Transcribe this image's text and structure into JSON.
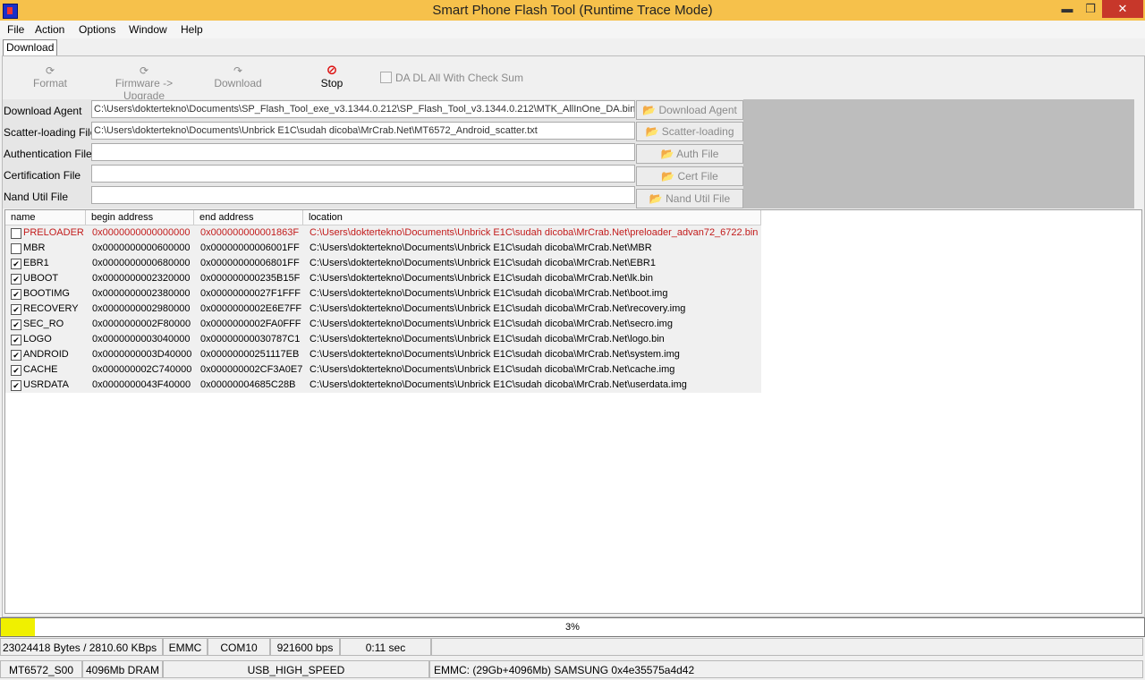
{
  "window": {
    "title": "Smart Phone Flash Tool (Runtime Trace Mode)",
    "min_glyph": "▬",
    "max_glyph": "❐",
    "close_glyph": "✕"
  },
  "menu": [
    "File",
    "Action",
    "Options",
    "Window",
    "Help"
  ],
  "tab": "Download",
  "toolbar": {
    "format": "Format",
    "firmware": "Firmware -> Upgrade",
    "download": "Download",
    "stop": "Stop",
    "format_icon": "⟳",
    "firmware_icon": "⟳",
    "download_icon": "↷",
    "stop_icon": "⊘",
    "da_checksum": "DA DL All With Check Sum"
  },
  "files": [
    {
      "label": "Download Agent",
      "value": "C:\\Users\\doktertekno\\Documents\\SP_Flash_Tool_exe_v3.1344.0.212\\SP_Flash_Tool_v3.1344.0.212\\MTK_AllInOne_DA.bin",
      "button": "Download Agent"
    },
    {
      "label": "Scatter-loading File",
      "value": "C:\\Users\\doktertekno\\Documents\\Unbrick E1C\\sudah dicoba\\MrCrab.Net\\MT6572_Android_scatter.txt",
      "button": "Scatter-loading"
    },
    {
      "label": "Authentication File",
      "value": "",
      "button": "Auth File"
    },
    {
      "label": "Certification File",
      "value": "",
      "button": "Cert File"
    },
    {
      "label": "Nand Util File",
      "value": "",
      "button": "Nand Util File"
    }
  ],
  "table": {
    "headers": [
      "name",
      "begin address",
      "end address",
      "location"
    ],
    "rows": [
      {
        "checked": false,
        "name": "PRELOADER",
        "begin": "0x0000000000000000",
        "end": "0x000000000001863F",
        "location": "C:\\Users\\doktertekno\\Documents\\Unbrick E1C\\sudah dicoba\\MrCrab.Net\\preloader_advan72_6722.bin",
        "highlight": true
      },
      {
        "checked": false,
        "name": "MBR",
        "begin": "0x0000000000600000",
        "end": "0x00000000006001FF",
        "location": "C:\\Users\\doktertekno\\Documents\\Unbrick E1C\\sudah dicoba\\MrCrab.Net\\MBR"
      },
      {
        "checked": true,
        "name": "EBR1",
        "begin": "0x0000000000680000",
        "end": "0x00000000006801FF",
        "location": "C:\\Users\\doktertekno\\Documents\\Unbrick E1C\\sudah dicoba\\MrCrab.Net\\EBR1"
      },
      {
        "checked": true,
        "name": "UBOOT",
        "begin": "0x0000000002320000",
        "end": "0x000000000235B15F",
        "location": "C:\\Users\\doktertekno\\Documents\\Unbrick E1C\\sudah dicoba\\MrCrab.Net\\lk.bin"
      },
      {
        "checked": true,
        "name": "BOOTIMG",
        "begin": "0x0000000002380000",
        "end": "0x00000000027F1FFF",
        "location": "C:\\Users\\doktertekno\\Documents\\Unbrick E1C\\sudah dicoba\\MrCrab.Net\\boot.img"
      },
      {
        "checked": true,
        "name": "RECOVERY",
        "begin": "0x0000000002980000",
        "end": "0x0000000002E6E7FF",
        "location": "C:\\Users\\doktertekno\\Documents\\Unbrick E1C\\sudah dicoba\\MrCrab.Net\\recovery.img"
      },
      {
        "checked": true,
        "name": "SEC_RO",
        "begin": "0x0000000002F80000",
        "end": "0x0000000002FA0FFF",
        "location": "C:\\Users\\doktertekno\\Documents\\Unbrick E1C\\sudah dicoba\\MrCrab.Net\\secro.img"
      },
      {
        "checked": true,
        "name": "LOGO",
        "begin": "0x0000000003040000",
        "end": "0x00000000030787C1",
        "location": "C:\\Users\\doktertekno\\Documents\\Unbrick E1C\\sudah dicoba\\MrCrab.Net\\logo.bin"
      },
      {
        "checked": true,
        "name": "ANDROID",
        "begin": "0x0000000003D40000",
        "end": "0x00000000251117EB",
        "location": "C:\\Users\\doktertekno\\Documents\\Unbrick E1C\\sudah dicoba\\MrCrab.Net\\system.img"
      },
      {
        "checked": true,
        "name": "CACHE",
        "begin": "0x000000002C740000",
        "end": "0x000000002CF3A0E7",
        "location": "C:\\Users\\doktertekno\\Documents\\Unbrick E1C\\sudah dicoba\\MrCrab.Net\\cache.img"
      },
      {
        "checked": true,
        "name": "USRDATA",
        "begin": "0x0000000043F40000",
        "end": "0x00000004685C28B",
        "location": "C:\\Users\\doktertekno\\Documents\\Unbrick E1C\\sudah dicoba\\MrCrab.Net\\userdata.img"
      }
    ]
  },
  "progress": {
    "percent": 3,
    "label": "3%",
    "color": "#f0f000"
  },
  "status1": {
    "bytes": "23024418 Bytes / 2810.60 KBps",
    "storage": "EMMC",
    "port": "COM10",
    "baud": "921600 bps",
    "time": "0:11 sec"
  },
  "status2": {
    "chip": "MT6572_S00",
    "dram": "4096Mb DRAM",
    "usb": "USB_HIGH_SPEED",
    "emmc": "EMMC: (29Gb+4096Mb) SAMSUNG 0x4e35575a4d42"
  }
}
